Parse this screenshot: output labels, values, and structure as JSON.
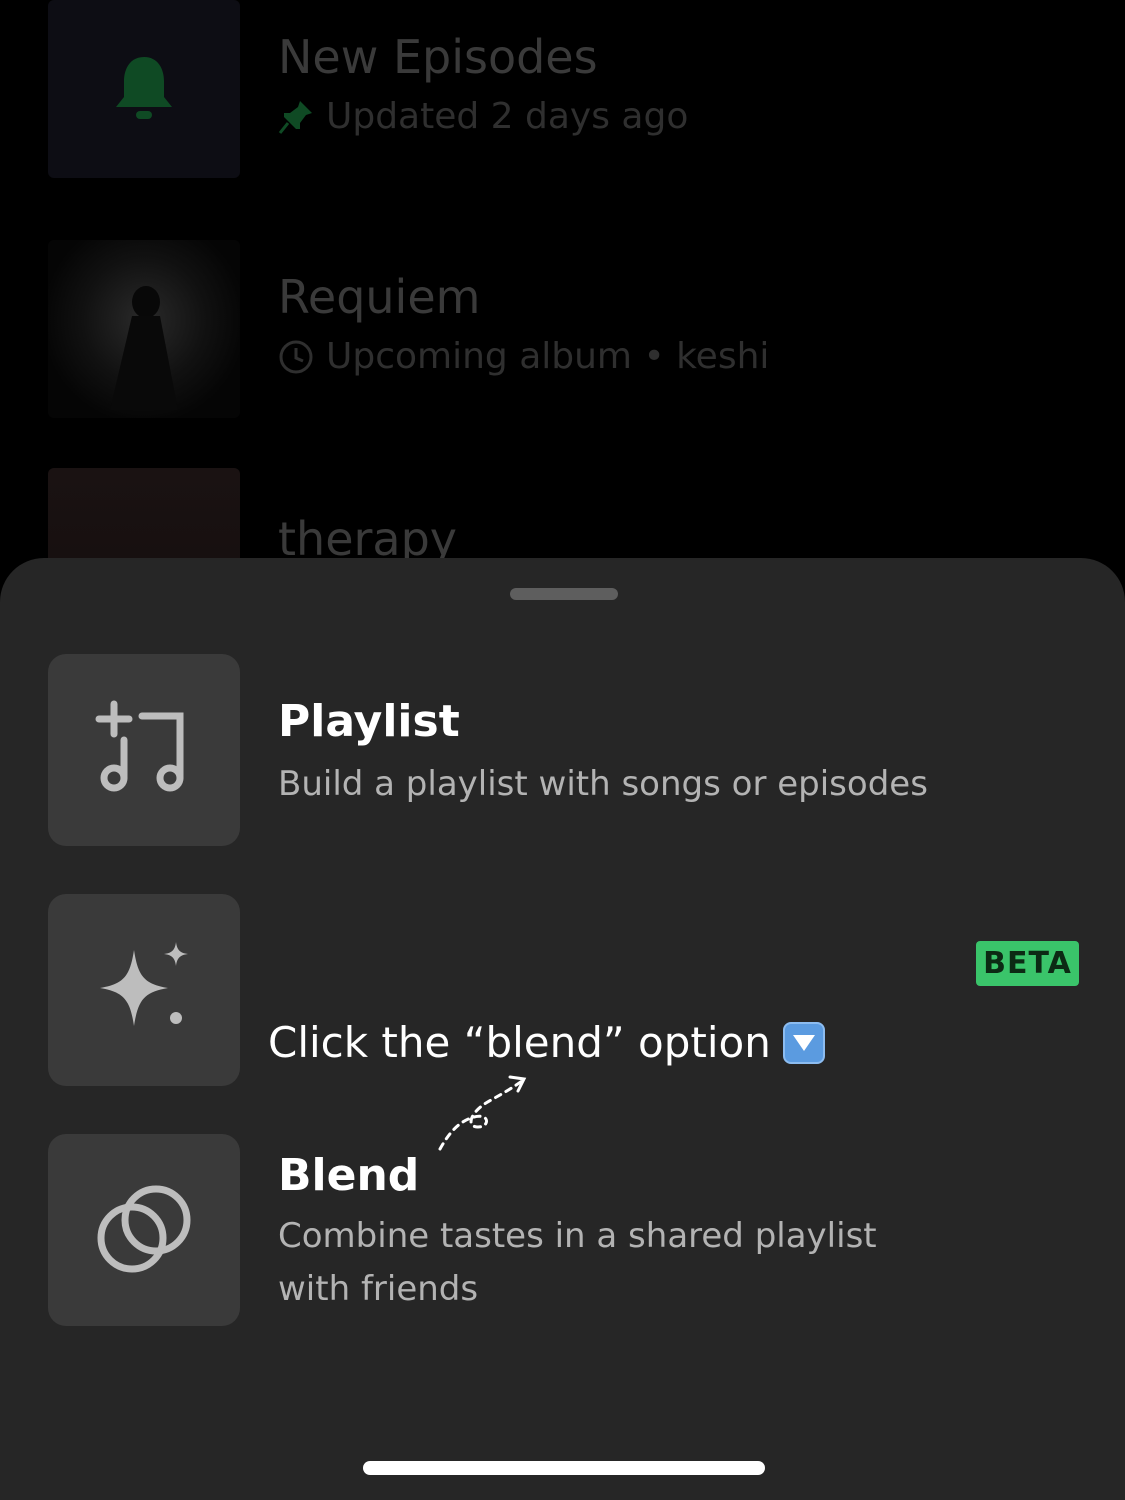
{
  "library": {
    "items": [
      {
        "title": "New Episodes",
        "subtitle": "Updated 2 days ago",
        "subtitle_icon": "pin-icon",
        "thumb_icon": "bell-icon"
      },
      {
        "title": "Requiem",
        "subtitle": "Upcoming album • keshi",
        "subtitle_icon": "clock-icon"
      },
      {
        "title": "therapy"
      }
    ]
  },
  "sheet": {
    "options": [
      {
        "title": "Playlist",
        "description": "Build a playlist with songs or episodes",
        "icon": "add-music-icon"
      },
      {
        "title": "",
        "description": "",
        "icon": "sparkle-icon",
        "badge": "BETA"
      },
      {
        "title": "Blend",
        "description_line1": "Combine tastes in a shared playlist",
        "description_line2": "with friends",
        "icon": "blend-circles-icon"
      }
    ],
    "annotation": "Click the “blend” option"
  },
  "colors": {
    "sheet_bg": "#262626",
    "tile_bg": "#3a3a3a",
    "beta_green": "#3ac46a",
    "accent_green": "#1db954"
  }
}
